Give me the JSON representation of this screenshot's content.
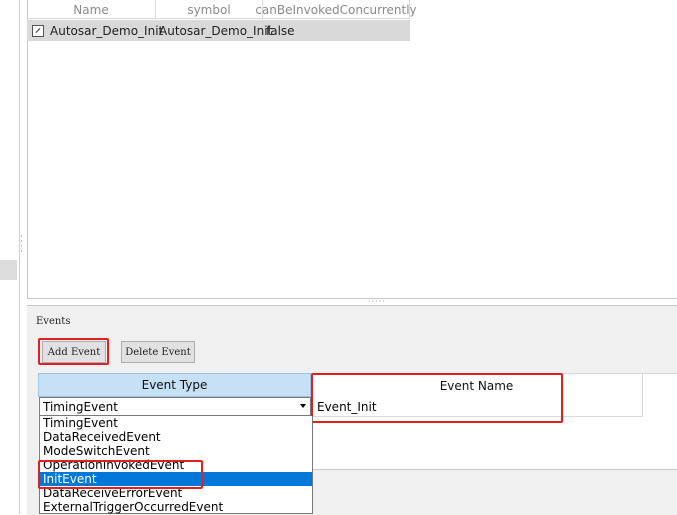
{
  "runnables_table": {
    "columns": [
      "Name",
      "symbol",
      "canBeInvokedConcurrently"
    ],
    "rows": [
      {
        "name": "Autosar_Demo_Init",
        "symbol": "Autosar_Demo_Init",
        "concurrent": "false"
      }
    ]
  },
  "events": {
    "section_label": "Events",
    "add_button": "Add Event",
    "delete_button": "Delete Event",
    "grid": {
      "col_type": "Event Type",
      "col_name": "Event Name",
      "row": {
        "type": "TimingEvent",
        "name": "Event_Init"
      }
    },
    "dropdown": {
      "options": [
        "TimingEvent",
        "DataReceivedEvent",
        "ModeSwitchEvent",
        "OperationInvokedEvent",
        "InitEvent",
        "DataReceiveErrorEvent",
        "ExternalTriggerOccurredEvent"
      ],
      "highlighted": "InitEvent"
    }
  },
  "colors": {
    "highlight_red": "#e02020",
    "selection_blue": "#0078d7",
    "header_blue": "#c6e0f5"
  }
}
